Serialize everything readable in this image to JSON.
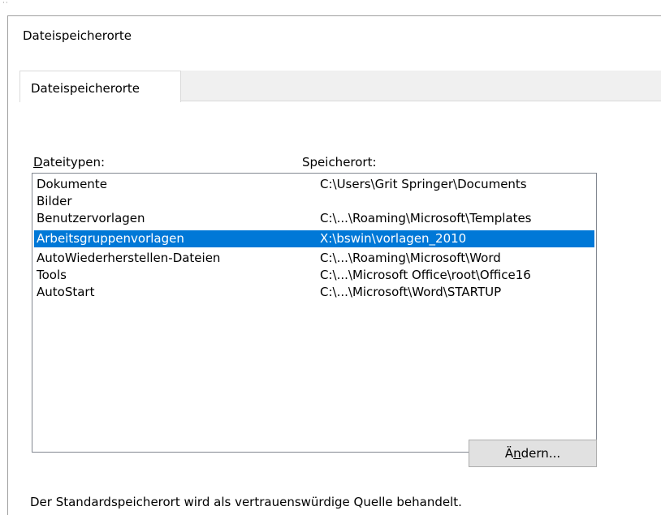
{
  "window": {
    "title": "Dateispeicherorte"
  },
  "tabs": [
    {
      "label": "Dateispeicherorte"
    }
  ],
  "columns": {
    "type_label_accesskey": "D",
    "type_label_rest": "ateitypen:",
    "location_label": "Speicherort:"
  },
  "rows": [
    {
      "type": "Dokumente",
      "location": "C:\\Users\\Grit Springer\\Documents",
      "selected": false
    },
    {
      "type": "Bilder",
      "location": "",
      "selected": false
    },
    {
      "type": "Benutzervorlagen",
      "location": "C:\\...\\Roaming\\Microsoft\\Templates",
      "selected": false
    },
    {
      "type": "Arbeitsgruppenvorlagen",
      "location": "X:\\bswin\\vorlagen_2010",
      "selected": true
    },
    {
      "type": "AutoWiederherstellen-Dateien",
      "location": "C:\\...\\Roaming\\Microsoft\\Word",
      "selected": false
    },
    {
      "type": "Tools",
      "location": "C:\\...\\Microsoft Office\\root\\Office16",
      "selected": false
    },
    {
      "type": "AutoStart",
      "location": "C:\\...\\Microsoft\\Word\\STARTUP",
      "selected": false
    }
  ],
  "buttons": {
    "change_pre": "Ä",
    "change_accesskey": "n",
    "change_post": "dern..."
  },
  "footer": {
    "note": "Der Standardspeicherort wird als vertrauenswürdige Quelle behandelt."
  },
  "colors": {
    "selection": "#0078d7",
    "selection_text": "#ffffff",
    "tabstrip": "#f0f0f0",
    "button_face": "#e1e1e1"
  }
}
